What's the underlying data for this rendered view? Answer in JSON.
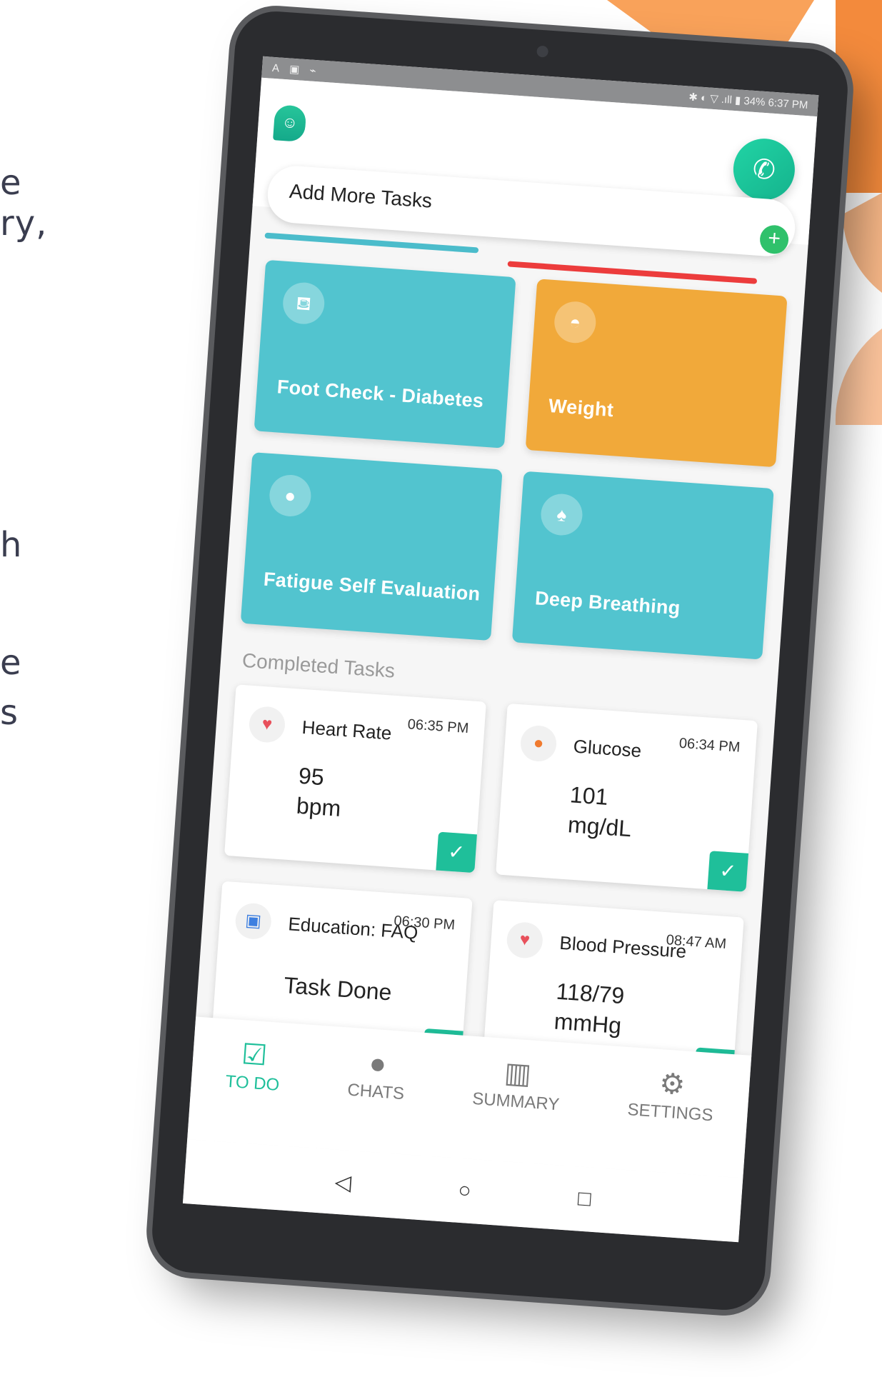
{
  "background": {
    "fragments": [
      "e",
      "ry,",
      "h",
      "e",
      "s"
    ],
    "accent": "#f5a05a"
  },
  "status_bar": {
    "left_icons": [
      "A",
      "▣",
      "⌁"
    ],
    "right_text": "✱ ◐ ▽ .ıll ▮ 34% 6:37 PM"
  },
  "header": {
    "logo_icon": "smile-chat-icon",
    "call_icon": "phone-icon",
    "add_tasks_label": "Add More Tasks",
    "add_icon": "plus-icon"
  },
  "tasks": [
    {
      "label": "Foot Check - Diabetes",
      "icon": "foot-icon",
      "glyph": "⛾",
      "color": "#52c4cf"
    },
    {
      "label": "Weight",
      "icon": "scale-icon",
      "glyph": "◓",
      "color": "#f1a93a"
    },
    {
      "label": "Fatigue Self Evaluation",
      "icon": "bulb-icon",
      "glyph": "●",
      "color": "#52c4cf"
    },
    {
      "label": "Deep Breathing",
      "icon": "lungs-icon",
      "glyph": "♠",
      "color": "#52c4cf"
    }
  ],
  "completed": {
    "title": "Completed Tasks",
    "items": [
      {
        "title": "Heart Rate",
        "time": "06:35 PM",
        "value": "95",
        "unit": "bpm",
        "icon": "heart-rate-icon",
        "glyph": "♥",
        "icon_color": "#e8505b"
      },
      {
        "title": "Glucose",
        "time": "06:34 PM",
        "value": "101",
        "unit": "mg/dL",
        "icon": "drop-icon",
        "glyph": "●",
        "icon_color": "#f07a2e"
      },
      {
        "title": "Education: FAQ",
        "time": "06:30 PM",
        "value": "Task Done",
        "unit": "",
        "icon": "book-icon",
        "glyph": "▣",
        "icon_color": "#3d7fe0"
      },
      {
        "title": "Blood Pressure",
        "time": "08:47 AM",
        "value": "118/79",
        "unit": "mmHg",
        "icon": "heart-icon",
        "glyph": "♥",
        "icon_color": "#e8505b"
      }
    ],
    "check_glyph": "✓"
  },
  "bottom_nav": [
    {
      "label": "TO DO",
      "icon": "clipboard-check-icon",
      "glyph": "☑",
      "active": true
    },
    {
      "label": "CHATS",
      "icon": "chat-bubble-icon",
      "glyph": "●",
      "active": false
    },
    {
      "label": "SUMMARY",
      "icon": "bar-chart-icon",
      "glyph": "▥",
      "active": false
    },
    {
      "label": "SETTINGS",
      "icon": "gear-icon",
      "glyph": "⚙",
      "active": false
    }
  ],
  "android_nav": {
    "back": "◁",
    "home": "○",
    "recent": "□"
  }
}
